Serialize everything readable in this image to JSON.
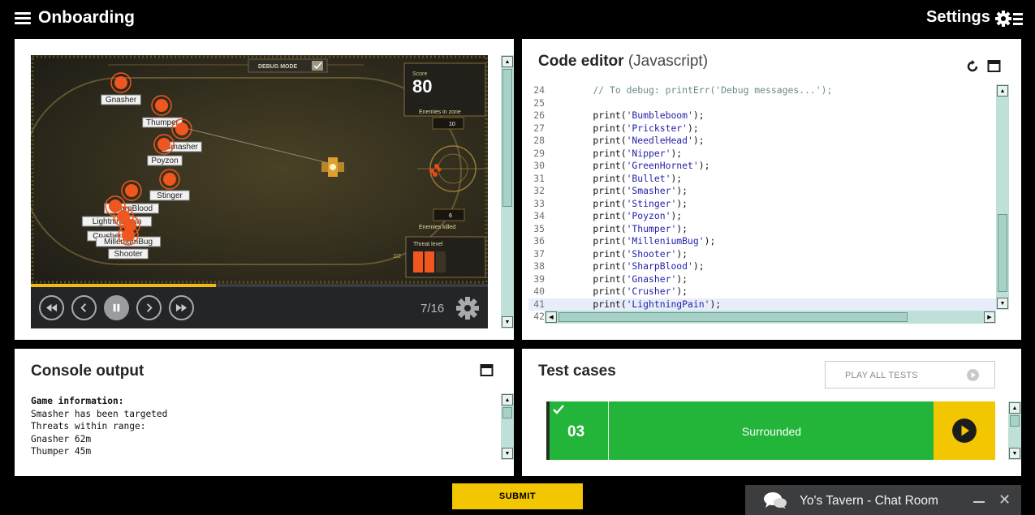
{
  "header": {
    "title": "Onboarding",
    "settings_label": "Settings"
  },
  "viewer": {
    "debug_mode_label": "DEBUG MODE",
    "hud": {
      "score_label": "Score",
      "score_value": "80",
      "enemies_in_zone_label": "Enemies in zone",
      "enemies_in_zone_value": "10",
      "enemies_killed_label": "Enemies killed",
      "enemies_killed_value": "6",
      "threat_level_label": "Threat level",
      "threat_level_code": "D2"
    },
    "enemies": [
      "Gnasher",
      "Thumper",
      "Smasher",
      "Poyzon",
      "Stinger",
      "SharpBlood",
      "LightningPain",
      "Crusher",
      "MilleniumBug",
      "Shooter"
    ],
    "progress": 0.405,
    "frame": "7/16"
  },
  "code_editor": {
    "title": "Code editor",
    "language": "(Javascript)",
    "lines": [
      {
        "n": "24",
        "pre": "    ",
        "comment": "// To debug: printErr('Debug messages...');"
      },
      {
        "n": "25",
        "pre": "",
        "comment": ""
      },
      {
        "n": "26",
        "pre": "    print(",
        "str": "'Bumbleboom'",
        "post": ");"
      },
      {
        "n": "27",
        "pre": "    print(",
        "str": "'Prickster'",
        "post": ");"
      },
      {
        "n": "28",
        "pre": "    print(",
        "str": "'NeedleHead'",
        "post": ");"
      },
      {
        "n": "29",
        "pre": "    print(",
        "str": "'Nipper'",
        "post": ");"
      },
      {
        "n": "30",
        "pre": "    print(",
        "str": "'GreenHornet'",
        "post": ");"
      },
      {
        "n": "31",
        "pre": "    print(",
        "str": "'Bullet'",
        "post": ");"
      },
      {
        "n": "32",
        "pre": "    print(",
        "str": "'Smasher'",
        "post": ");"
      },
      {
        "n": "33",
        "pre": "    print(",
        "str": "'Stinger'",
        "post": ");"
      },
      {
        "n": "34",
        "pre": "    print(",
        "str": "'Poyzon'",
        "post": ");"
      },
      {
        "n": "35",
        "pre": "    print(",
        "str": "'Thumper'",
        "post": ");"
      },
      {
        "n": "36",
        "pre": "    print(",
        "str": "'MilleniumBug'",
        "post": ");"
      },
      {
        "n": "37",
        "pre": "    print(",
        "str": "'Shooter'",
        "post": ");"
      },
      {
        "n": "38",
        "pre": "    print(",
        "str": "'SharpBlood'",
        "post": ");"
      },
      {
        "n": "39",
        "pre": "    print(",
        "str": "'Gnasher'",
        "post": ");"
      },
      {
        "n": "40",
        "pre": "    print(",
        "str": "'Crusher'",
        "post": ");"
      },
      {
        "n": "41",
        "pre": "    print(",
        "str": "'LightningPain'",
        "post": ");",
        "active": true
      },
      {
        "n": "42",
        "pre": "",
        "comment": ""
      }
    ]
  },
  "console": {
    "title": "Console output",
    "header_line": "Game information:",
    "lines": [
      "Smasher has been targeted",
      "Threats within range:",
      "Gnasher 62m",
      "Thumper 45m"
    ]
  },
  "tests": {
    "title": "Test cases",
    "play_all_label": "PLAY ALL TESTS",
    "case": {
      "number": "03",
      "name": "Surrounded",
      "status": "passed"
    }
  },
  "footer": {
    "submit_label": "SUBMIT",
    "chat_label": "Yo's Tavern - Chat Room"
  },
  "colors": {
    "accent": "#f2c600",
    "pass_green": "#22b53a",
    "enemy_orange": "#f0561d",
    "hud_gold": "#c49a3a"
  }
}
